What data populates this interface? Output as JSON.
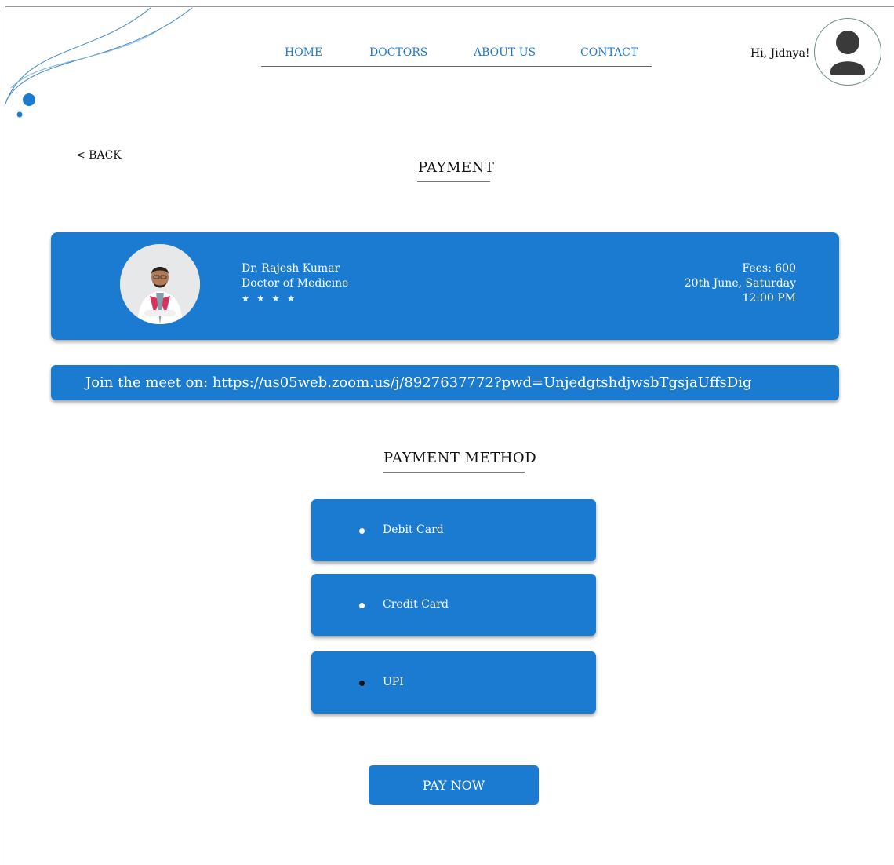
{
  "nav": {
    "items": [
      {
        "label": "HOME"
      },
      {
        "label": "DOCTORS"
      },
      {
        "label": "ABOUT US"
      },
      {
        "label": "CONTACT"
      }
    ]
  },
  "user": {
    "greeting": "Hi, Jidnya!",
    "avatar_icon": "user-silhouette-icon"
  },
  "back_label": "< BACK",
  "page_title": "PAYMENT",
  "doctor": {
    "name": "Dr. Rajesh Kumar",
    "specialty": "Doctor of Medicine",
    "rating_stars": "★ ★ ★ ★",
    "rating": 4,
    "fees": "Fees: 600",
    "date": "20th June, Saturday",
    "time": "12:00 PM"
  },
  "meeting": {
    "text": "Join the meet on: https://us05web.zoom.us/j/8927637772?pwd=UnjedgtshdjwsbTgsjaUffsDig"
  },
  "payment_method": {
    "title": "PAYMENT METHOD",
    "options": [
      {
        "label": "Debit Card",
        "selected": false
      },
      {
        "label": "Credit Card",
        "selected": false
      },
      {
        "label": "UPI",
        "selected": true
      }
    ]
  },
  "pay_button_label": "PAY NOW",
  "colors": {
    "primary": "#1a7bd0",
    "nav_link": "#1a78cf",
    "avatar_fill": "#3a3a3a"
  }
}
